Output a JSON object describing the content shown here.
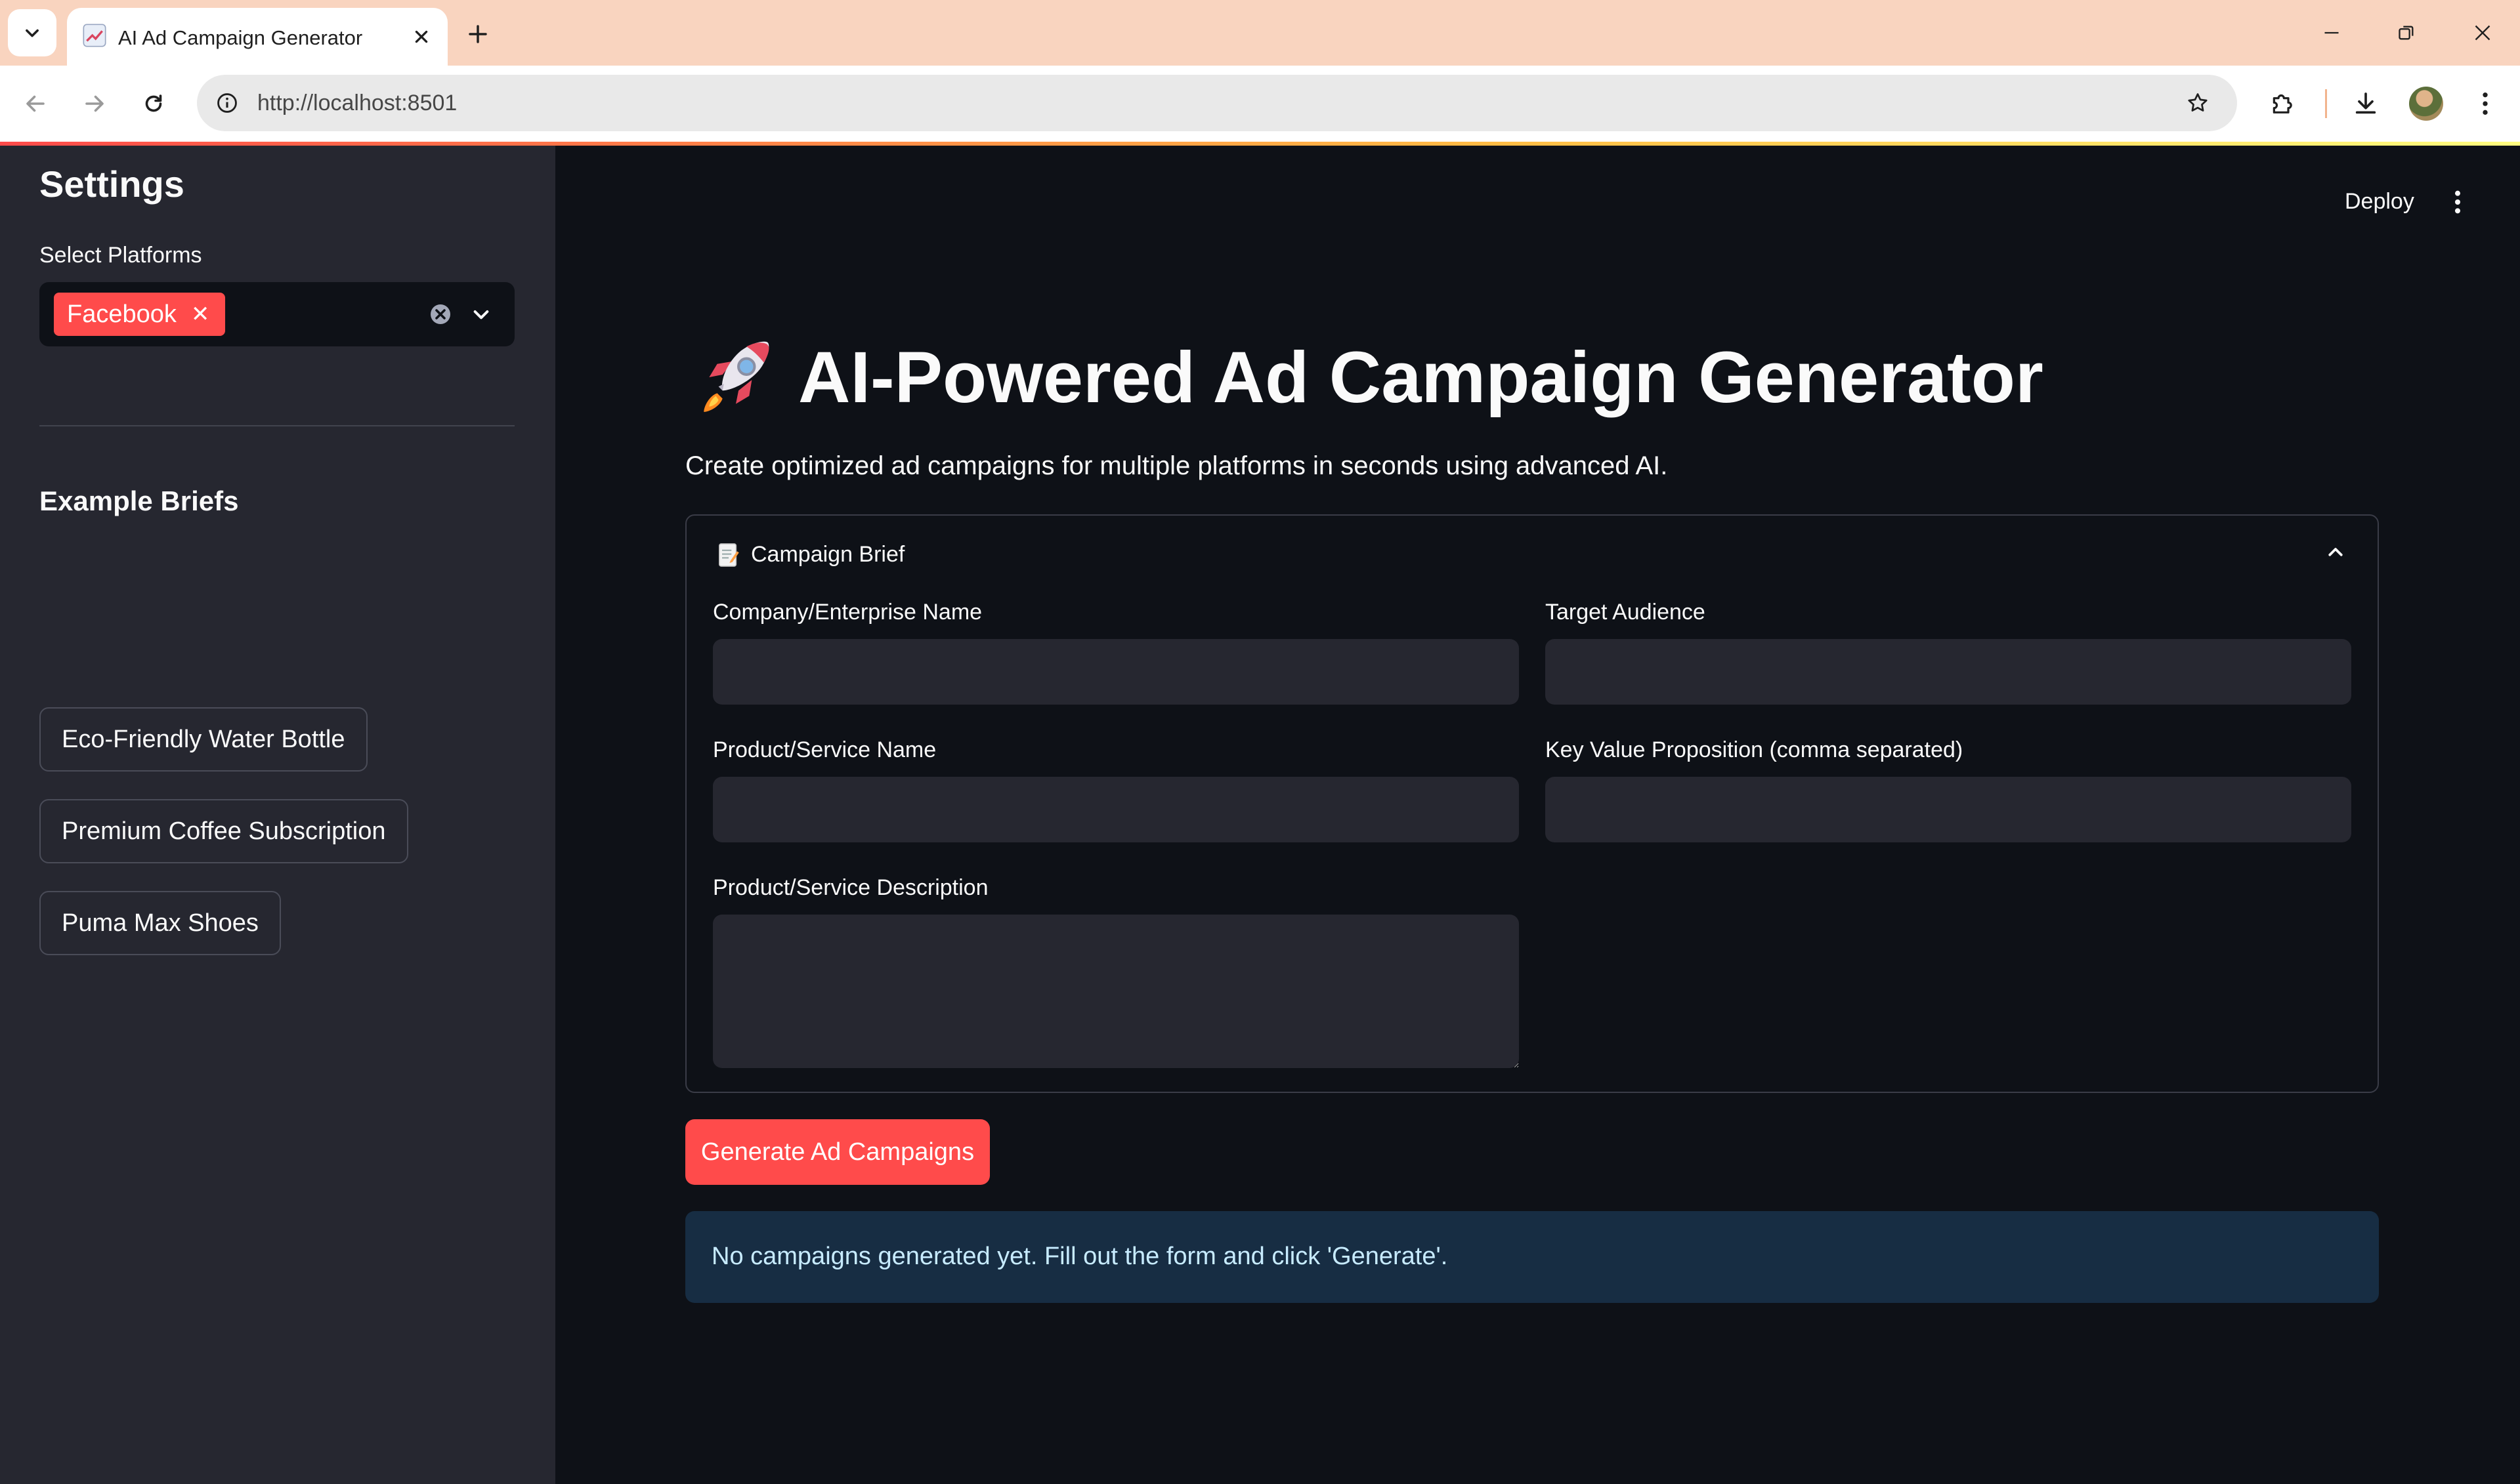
{
  "browser": {
    "tab_title": "AI Ad Campaign Generator",
    "url": "http://localhost:8501"
  },
  "header": {
    "deploy_label": "Deploy"
  },
  "sidebar": {
    "title": "Settings",
    "platforms_label": "Select Platforms",
    "selected_platforms": [
      "Facebook"
    ],
    "examples_title": "Example Briefs",
    "examples": [
      "Eco-Friendly Water Bottle",
      "Premium Coffee Subscription",
      "Puma Max Shoes"
    ]
  },
  "main": {
    "title": "AI-Powered Ad Campaign Generator",
    "subtitle": "Create optimized ad campaigns for multiple platforms in seconds using advanced AI.",
    "brief": {
      "title": "Campaign Brief",
      "company_label": "Company/Enterprise Name",
      "company_value": "",
      "audience_label": "Target Audience",
      "audience_value": "",
      "product_label": "Product/Service Name",
      "product_value": "",
      "value_prop_label": "Key Value Proposition (comma separated)",
      "value_prop_value": "",
      "description_label": "Product/Service Description",
      "description_value": ""
    },
    "generate_label": "Generate Ad Campaigns",
    "info_message": "No campaigns generated yet. Fill out the form and click 'Generate'."
  },
  "colors": {
    "primary": "#ff4b4b",
    "background": "#0e1117",
    "sidebar": "#262730",
    "info_bg": "#172d43",
    "info_text": "#c7ebff"
  }
}
